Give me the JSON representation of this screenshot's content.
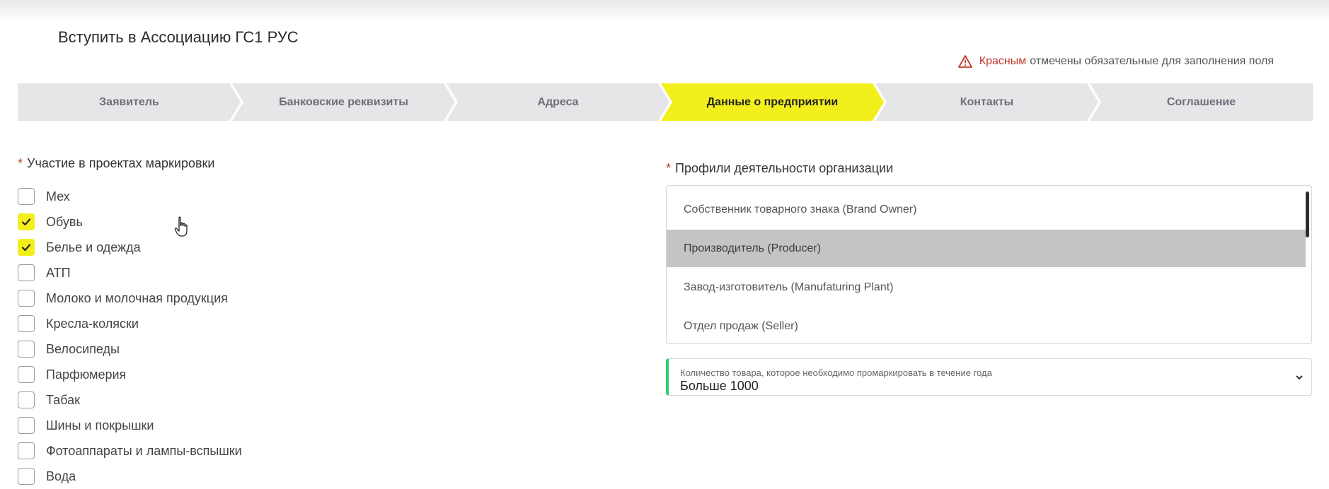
{
  "page": {
    "title": "Вступить в Ассоциацию ГС1 РУС",
    "required_note_red": "Красным",
    "required_note_rest": "отмечены обязательные для заполнения поля"
  },
  "steps": [
    {
      "label": "Заявитель",
      "active": false
    },
    {
      "label": "Банковские реквизиты",
      "active": false
    },
    {
      "label": "Адреса",
      "active": false
    },
    {
      "label": "Данные о предприятии",
      "active": true
    },
    {
      "label": "Контакты",
      "active": false
    },
    {
      "label": "Соглашение",
      "active": false
    }
  ],
  "marking": {
    "label": "Участие в проектах маркировки",
    "required_mark": "*",
    "items": [
      {
        "label": "Мех",
        "checked": false
      },
      {
        "label": "Обувь",
        "checked": true
      },
      {
        "label": "Белье и одежда",
        "checked": true
      },
      {
        "label": "АТП",
        "checked": false
      },
      {
        "label": "Молоко и молочная продукция",
        "checked": false
      },
      {
        "label": "Кресла-коляски",
        "checked": false
      },
      {
        "label": "Велосипеды",
        "checked": false
      },
      {
        "label": "Парфюмерия",
        "checked": false
      },
      {
        "label": "Табак",
        "checked": false
      },
      {
        "label": "Шины и покрышки",
        "checked": false
      },
      {
        "label": "Фотоаппараты и лампы-вспышки",
        "checked": false
      },
      {
        "label": "Вода",
        "checked": false
      }
    ]
  },
  "profiles": {
    "label": "Профили деятельности организации",
    "required_mark": "*",
    "options": [
      {
        "label": "Собственник товарного знака (Brand Owner)",
        "selected": false
      },
      {
        "label": "Производитель (Producer)",
        "selected": true
      },
      {
        "label": "Завод-изготовитель (Manufaturing Plant)",
        "selected": false
      },
      {
        "label": "Отдел продаж (Seller)",
        "selected": false
      }
    ]
  },
  "quantity": {
    "caption": "Количество товара, которое необходимо промаркировать в течение года",
    "value": "Больше 1000"
  },
  "colors": {
    "accent": "#f3ef1c",
    "required": "#c0392b",
    "valid": "#2ecc71",
    "step_bg": "#e6e6e8",
    "selected_option": "#c4c4c4"
  }
}
